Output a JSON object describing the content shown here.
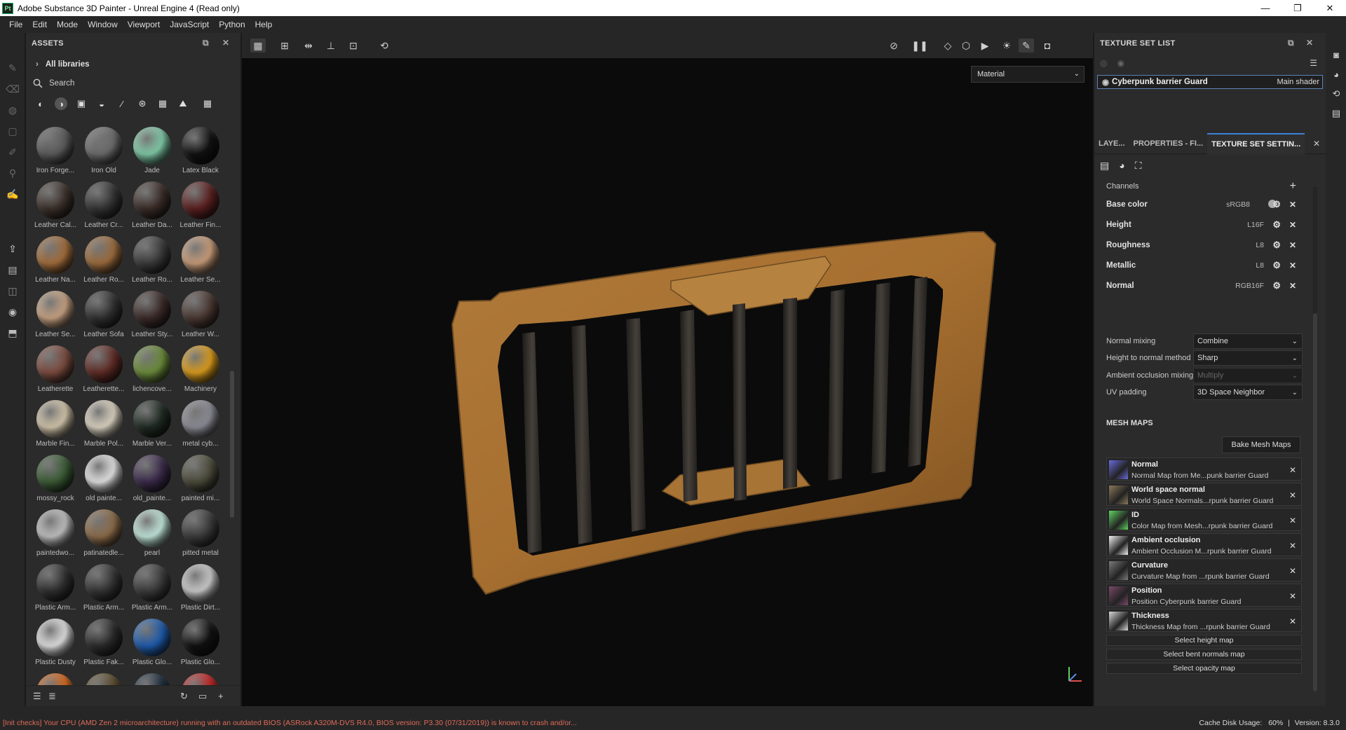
{
  "window": {
    "app_icon": "Pt",
    "title": "Adobe Substance 3D Painter - Unreal Engine 4 (Read only)",
    "controls": [
      "—",
      "❐",
      "✕"
    ]
  },
  "menu": [
    "File",
    "Edit",
    "Mode",
    "Window",
    "Viewport",
    "JavaScript",
    "Python",
    "Help"
  ],
  "assets": {
    "title": "ASSETS",
    "libraries": "All libraries",
    "search_placeholder": "Search",
    "materials": [
      {
        "label": "Iron Forge...",
        "color": "#5a5a5a"
      },
      {
        "label": "Iron Old",
        "color": "#6a6a6a"
      },
      {
        "label": "Jade",
        "color": "#7fc8a6"
      },
      {
        "label": "Latex Black",
        "color": "#111111"
      },
      {
        "label": "Leather Cal...",
        "color": "#3b302a"
      },
      {
        "label": "Leather Cr...",
        "color": "#333333"
      },
      {
        "label": "Leather Da...",
        "color": "#3a2c28"
      },
      {
        "label": "Leather Fin...",
        "color": "#5a1f1f"
      },
      {
        "label": "Leather Na...",
        "color": "#a06b3a"
      },
      {
        "label": "Leather Ro...",
        "color": "#9a6a3c"
      },
      {
        "label": "Leather Ro...",
        "color": "#3a3a3a"
      },
      {
        "label": "Leather Se...",
        "color": "#c69a78"
      },
      {
        "label": "Leather Se...",
        "color": "#c4a080"
      },
      {
        "label": "Leather Sofa",
        "color": "#303030"
      },
      {
        "label": "Leather Sty...",
        "color": "#3a2a28"
      },
      {
        "label": "Leather W...",
        "color": "#4a3832"
      },
      {
        "label": "Leatherette",
        "color": "#7a4a3e"
      },
      {
        "label": "Leatherette...",
        "color": "#5e2a24"
      },
      {
        "label": "lichencove...",
        "color": "#6a8a3a"
      },
      {
        "label": "Machinery",
        "color": "#d89a1c"
      },
      {
        "label": "Marble Fin...",
        "color": "#cfc2a8"
      },
      {
        "label": "Marble Pol...",
        "color": "#d8d0be"
      },
      {
        "label": "Marble Ver...",
        "color": "#1f2a22"
      },
      {
        "label": "metal cyb...",
        "color": "#8a8a94"
      },
      {
        "label": "mossy_rock",
        "color": "#3a5a34"
      },
      {
        "label": "old painte...",
        "color": "#e0e0e0"
      },
      {
        "label": "old_painte...",
        "color": "#3a2a4a"
      },
      {
        "label": "painted mi...",
        "color": "#4a4a3a"
      },
      {
        "label": "paintedwo...",
        "color": "#bdbdbd"
      },
      {
        "label": "patinatedle...",
        "color": "#8a6a48"
      },
      {
        "label": "pearl",
        "color": "#bfe3d8"
      },
      {
        "label": "pitted metal",
        "color": "#3a3a3a"
      },
      {
        "label": "Plastic Arm...",
        "color": "#2e2e2e"
      },
      {
        "label": "Plastic Arm...",
        "color": "#333333"
      },
      {
        "label": "Plastic Arm...",
        "color": "#3a3a3a"
      },
      {
        "label": "Plastic Dirt...",
        "color": "#c8c8c8"
      },
      {
        "label": "Plastic Dusty",
        "color": "#dcdcdc"
      },
      {
        "label": "Plastic Fak...",
        "color": "#2a2a2a"
      },
      {
        "label": "Plastic Glo...",
        "color": "#1e5aaa"
      },
      {
        "label": "Plastic Glo...",
        "color": "#111111"
      },
      {
        "label": "",
        "color": "#d4651a"
      },
      {
        "label": "",
        "color": "#5a4a2a"
      },
      {
        "label": "",
        "color": "#1a2a3a"
      },
      {
        "label": "",
        "color": "#c22222"
      }
    ]
  },
  "viewport": {
    "mode_select": "Material"
  },
  "texture_set_list": {
    "title": "TEXTURE SET LIST",
    "item_name": "Cyberpunk barrier Guard",
    "item_shader": "Main shader"
  },
  "tabs": {
    "layers": "LAYE...",
    "properties": "PROPERTIES - FI...",
    "texture_set_settings": "TEXTURE SET SETTIN..."
  },
  "channels": {
    "title": "Channels",
    "items": [
      {
        "name": "Base color",
        "format": "sRGB8"
      },
      {
        "name": "Height",
        "format": "L16F"
      },
      {
        "name": "Roughness",
        "format": "L8"
      },
      {
        "name": "Metallic",
        "format": "L8"
      },
      {
        "name": "Normal",
        "format": "RGB16F"
      }
    ]
  },
  "options": [
    {
      "label": "Normal mixing",
      "value": "Combine",
      "disabled": false
    },
    {
      "label": "Height to normal method",
      "value": "Sharp",
      "disabled": false
    },
    {
      "label": "Ambient occlusion mixing",
      "value": "Multiply",
      "disabled": true
    },
    {
      "label": "UV padding",
      "value": "3D Space Neighbor",
      "disabled": false
    }
  ],
  "mesh_maps": {
    "title": "MESH MAPS",
    "bake_button": "Bake Mesh Maps",
    "items": [
      {
        "name": "Normal",
        "desc": "Normal Map from Me...punk barrier Guard",
        "thumb": "#6a6adf"
      },
      {
        "name": "World space normal",
        "desc": "World Space Normals...rpunk barrier Guard",
        "thumb": "#8a7a5a"
      },
      {
        "name": "ID",
        "desc": "Color Map from Mesh...rpunk barrier Guard",
        "thumb": "#5fd25f"
      },
      {
        "name": "Ambient occlusion",
        "desc": "Ambient Occlusion M...rpunk barrier Guard",
        "thumb": "#f0f0f0"
      },
      {
        "name": "Curvature",
        "desc": "Curvature Map from ...rpunk barrier Guard",
        "thumb": "#7a7a7a"
      },
      {
        "name": "Position",
        "desc": "Position Cyberpunk barrier Guard",
        "thumb": "#7a4a6a"
      },
      {
        "name": "Thickness",
        "desc": "Thickness Map from ...rpunk barrier Guard",
        "thumb": "#d8d8d8"
      }
    ],
    "select_buttons": [
      "Select height map",
      "Select bent normals map",
      "Select opacity map"
    ]
  },
  "status": {
    "error": "[Init checks] Your CPU (AMD Zen 2 microarchitecture) running with an outdated BIOS (ASRock A320M-DVS R4.0, BIOS version: P3.30 (07/31/2019)) is known to crash and/or...",
    "cache": "Cache Disk Usage:",
    "cache_value": "60%",
    "version": "Version: 8.3.0"
  }
}
